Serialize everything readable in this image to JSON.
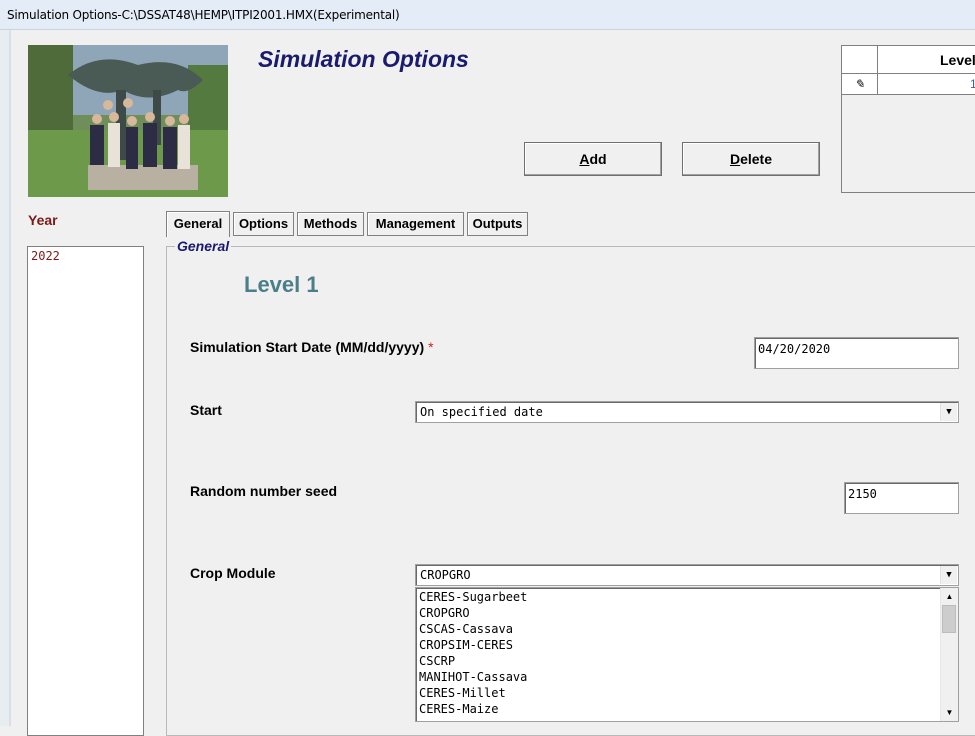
{
  "window": {
    "title": "Simulation Options-C:\\DSSAT48\\HEMP\\ITPI2001.HMX(Experimental)"
  },
  "header": {
    "title": "Simulation Options",
    "add_label": "Add",
    "add_mnemonic": "A",
    "add_rest": "dd",
    "delete_label": "Delete",
    "delete_mnemonic": "D",
    "delete_rest": "elete"
  },
  "grid": {
    "header_label": "Level",
    "row_indicator": "✎",
    "row_value": "1"
  },
  "year": {
    "label": "Year",
    "items": [
      "2022"
    ]
  },
  "tabs": [
    "General",
    "Options",
    "Methods",
    "Management",
    "Outputs"
  ],
  "active_tab": "General",
  "general": {
    "group_title": "General",
    "level_heading": "Level 1",
    "start_date_label": "Simulation Start Date (MM/dd/yyyy)",
    "required_marker": "*",
    "start_date_value": "04/20/2020",
    "start_label": "Start",
    "start_value": "On specified date",
    "seed_label": "Random number seed",
    "seed_value": "2150",
    "crop_module_label": "Crop Module",
    "crop_module_value": "CROPGRO",
    "crop_module_options": [
      "CERES-Sugarbeet",
      "CROPGRO",
      "CSCAS-Cassava",
      "CROPSIM-CERES",
      "CSCRP",
      "MANIHOT-Cassava",
      "CERES-Millet",
      "CERES-Maize"
    ]
  },
  "icons": {
    "dropdown": "chevron-down-icon",
    "scroll_up": "scroll-up-icon",
    "scroll_down": "scroll-down-icon",
    "edit_row": "pencil-icon"
  }
}
